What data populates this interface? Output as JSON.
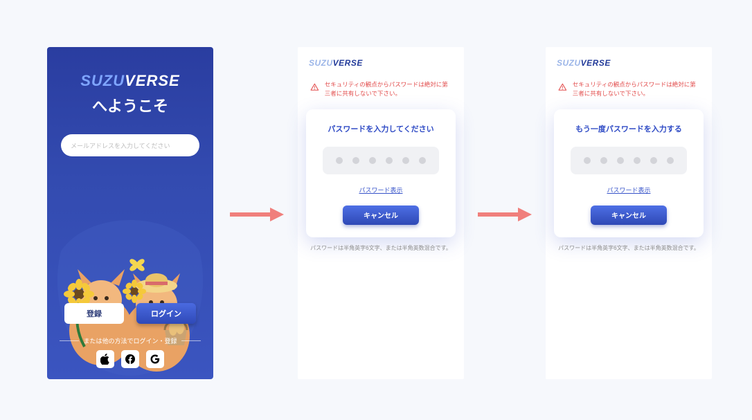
{
  "brand": {
    "suzu": "SUZU",
    "verse": "VERSE"
  },
  "screen1": {
    "welcome": "へようこそ",
    "email_placeholder": "メールアドレスを入力してください",
    "register_label": "登録",
    "login_label": "ログイン",
    "alt_methods_label": "または他の方法でログイン・登録",
    "social": {
      "apple": "apple",
      "facebook": "facebook",
      "google": "google"
    }
  },
  "screen2": {
    "warning": "セキュリティの観点からパスワードは絶対に第三者に共有しないで下さい。",
    "title": "パスワードを入力してください",
    "show_password": "パスワード表示",
    "cancel": "キャンセル",
    "hint": "パスワードは半角英字6文字、または半角英数混合です。"
  },
  "screen3": {
    "warning": "セキュリティの観点からパスワードは絶対に第三者に共有しないで下さい。",
    "title": "もう一度パスワードを入力する",
    "show_password": "パスワード表示",
    "cancel": "キャンセル",
    "hint": "パスワードは半角英字6文字、または半角英数混合です。"
  }
}
